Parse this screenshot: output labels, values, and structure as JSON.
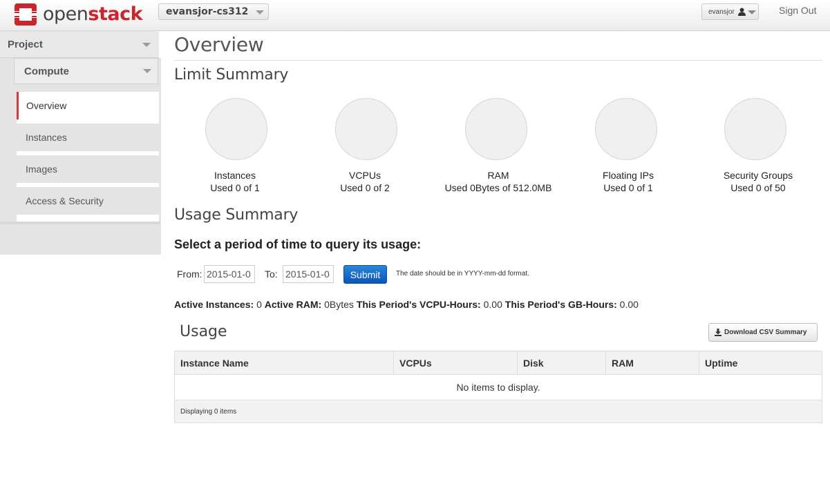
{
  "header": {
    "logo_text_1": "open",
    "logo_text_2": "stack",
    "project_selector": "evansjor-cs312",
    "user_menu": "evansjor",
    "sign_out": "Sign Out",
    "brand_color": "#c9252c"
  },
  "sidebar": {
    "dashboard": "Project",
    "panel": "Compute",
    "items": [
      {
        "label": "Overview",
        "active": true
      },
      {
        "label": "Instances",
        "active": false
      },
      {
        "label": "Images",
        "active": false
      },
      {
        "label": "Access & Security",
        "active": false
      }
    ]
  },
  "main": {
    "title": "Overview",
    "limit_summary": {
      "heading": "Limit Summary",
      "items": [
        {
          "name": "Instances",
          "usage": "Used 0 of 1"
        },
        {
          "name": "VCPUs",
          "usage": "Used 0 of 2"
        },
        {
          "name": "RAM",
          "usage": "Used 0Bytes of 512.0MB"
        },
        {
          "name": "Floating IPs",
          "usage": "Used 0 of 1"
        },
        {
          "name": "Security Groups",
          "usage": "Used 0 of 50"
        }
      ]
    },
    "usage_summary": {
      "heading": "Usage Summary",
      "query_heading": "Select a period of time to query its usage:",
      "from_label": "From:",
      "from_value": "2015-01-0",
      "to_label": "To:",
      "to_value": "2015-01-0",
      "submit_label": "Submit",
      "help_text": "The date should be in YYYY-mm-dd format.",
      "stats": [
        {
          "label": "Active Instances:",
          "value": "0"
        },
        {
          "label": "Active RAM:",
          "value": "0Bytes"
        },
        {
          "label": "This Period's VCPU-Hours:",
          "value": "0.00"
        },
        {
          "label": "This Period's GB-Hours:",
          "value": "0.00"
        }
      ]
    },
    "usage": {
      "heading": "Usage",
      "download_label": "Download CSV Summary",
      "columns": [
        "Instance Name",
        "VCPUs",
        "Disk",
        "RAM",
        "Uptime"
      ],
      "empty_text": "No items to display.",
      "footer": "Displaying 0 items"
    }
  }
}
